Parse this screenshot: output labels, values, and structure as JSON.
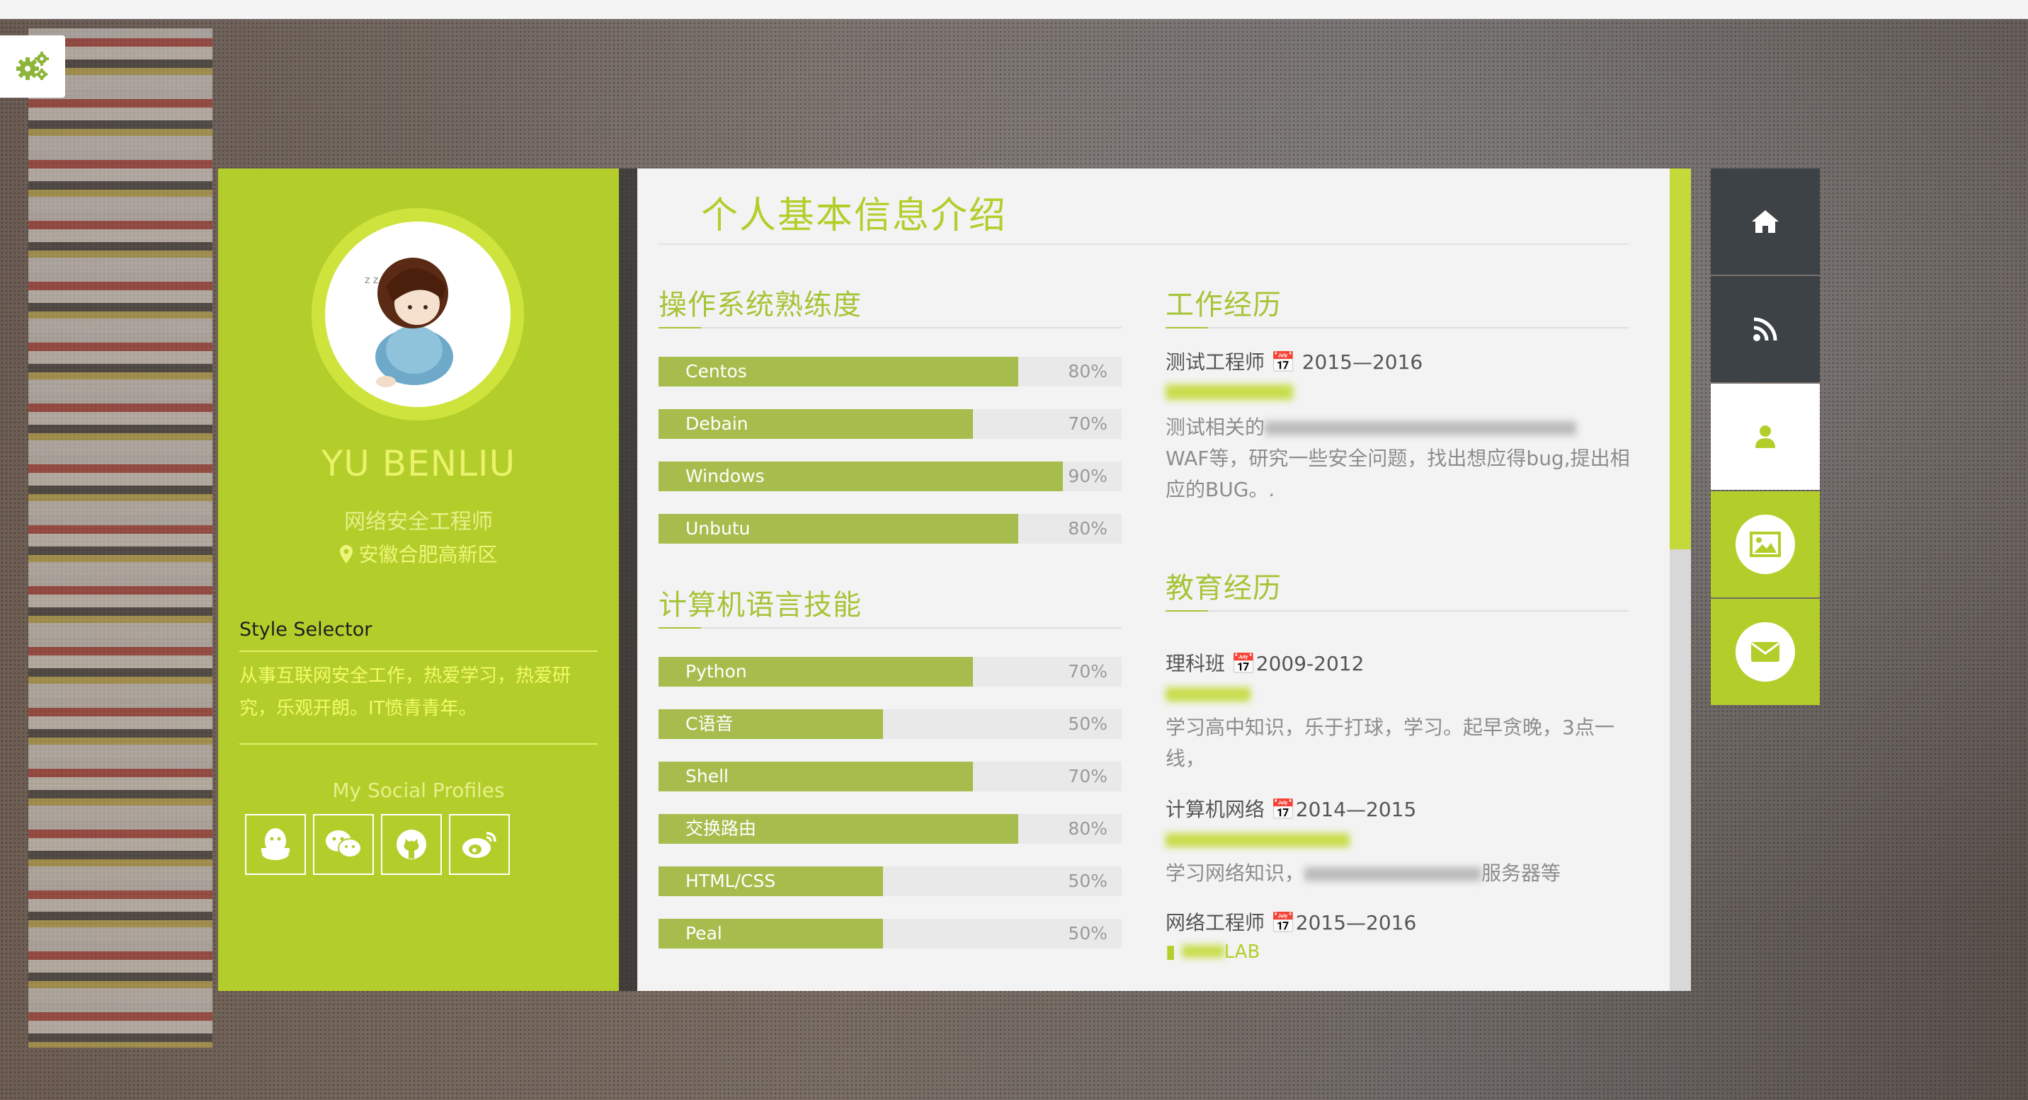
{
  "profile": {
    "name": "YU BENLIU",
    "title": "网络安全工程师",
    "location": "安徽合肥高新区",
    "style_selector": "Style Selector",
    "bio": "从事互联网安全工作，热爱学习，热爱研究，乐观开朗。IT愤青青年。",
    "social_title": "My Social Profiles",
    "social_icons": [
      "qq-icon",
      "wechat-icon",
      "github-icon",
      "weibo-icon"
    ]
  },
  "main": {
    "title": "个人基本信息介绍",
    "os_section": {
      "title": "操作系统熟练度",
      "skills": [
        {
          "label": "Centos",
          "percent": 80,
          "percent_text": "80%"
        },
        {
          "label": "Debain",
          "percent": 70,
          "percent_text": "70%"
        },
        {
          "label": "Windows",
          "percent": 90,
          "percent_text": "90%"
        },
        {
          "label": "Unbutu",
          "percent": 80,
          "percent_text": "80%"
        }
      ]
    },
    "lang_section": {
      "title": "计算机语言技能",
      "skills": [
        {
          "label": "Python",
          "percent": 70,
          "percent_text": "70%"
        },
        {
          "label": "C语音",
          "percent": 50,
          "percent_text": "50%"
        },
        {
          "label": "Shell",
          "percent": 70,
          "percent_text": "70%"
        },
        {
          "label": "交换路由",
          "percent": 80,
          "percent_text": "80%"
        },
        {
          "label": "HTML/CSS",
          "percent": 50,
          "percent_text": "50%"
        },
        {
          "label": "Peal",
          "percent": 50,
          "percent_text": "50%"
        }
      ]
    },
    "work_section": {
      "title": "工作经历",
      "entries": [
        {
          "role": "测试工程师",
          "dates": "2015—2016",
          "desc_line1": "测试相关的",
          "desc_rest": "WAF等，研究一些安全问题，找出想应得bug,提出相应的BUG。."
        }
      ]
    },
    "edu_section": {
      "title": "教育经历",
      "entries": [
        {
          "role": "理科班",
          "dates": "2009-2012",
          "desc": "学习高中知识，乐于打球，学习。起早贪晚，3点一线，"
        },
        {
          "role": "计算机网络",
          "dates": "2014—2015",
          "desc": "学习网络知识，",
          "desc_tail": "服务器等"
        },
        {
          "role": "网络工程师",
          "dates": "2015—2016",
          "sub": "LAB"
        }
      ]
    }
  },
  "nav": {
    "items": [
      "home-icon",
      "rss-icon",
      "user-icon",
      "image-icon",
      "mail-icon"
    ]
  },
  "colors": {
    "accent": "#b3ce2b",
    "bar": "#a6bd4d",
    "panel": "#f3f3f3",
    "nav_dark": "#3d4246"
  }
}
